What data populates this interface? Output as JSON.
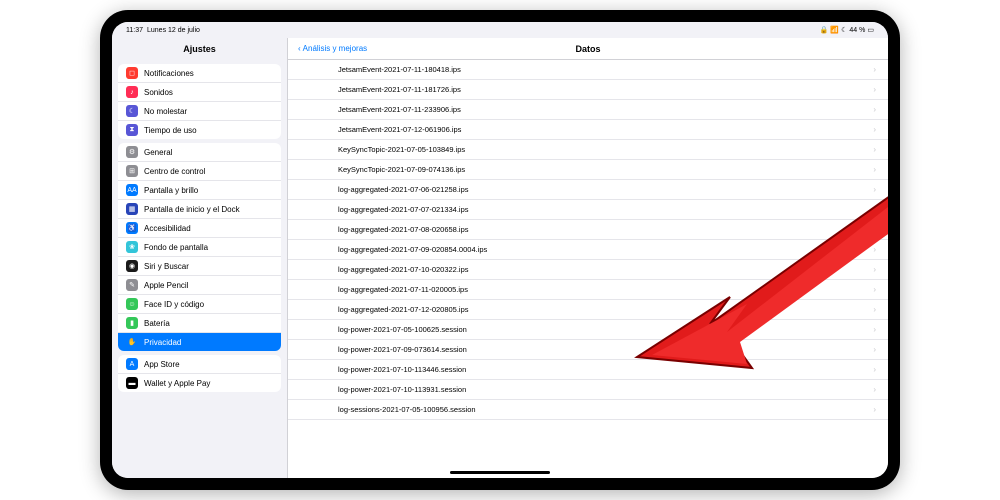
{
  "status": {
    "time": "11:37",
    "date": "Lunes 12 de julio",
    "battery": "44 %"
  },
  "sidebar": {
    "title": "Ajustes",
    "groups": [
      {
        "items": [
          {
            "label": "Notificaciones",
            "icon_bg": "#ff3b30",
            "glyph": "◻"
          },
          {
            "label": "Sonidos",
            "icon_bg": "#ff2d55",
            "glyph": "♪"
          },
          {
            "label": "No molestar",
            "icon_bg": "#5856d6",
            "glyph": "☾"
          },
          {
            "label": "Tiempo de uso",
            "icon_bg": "#5856d6",
            "glyph": "⧗"
          }
        ]
      },
      {
        "items": [
          {
            "label": "General",
            "icon_bg": "#8e8e93",
            "glyph": "⚙"
          },
          {
            "label": "Centro de control",
            "icon_bg": "#8e8e93",
            "glyph": "⊞"
          },
          {
            "label": "Pantalla y brillo",
            "icon_bg": "#007aff",
            "glyph": "AA"
          },
          {
            "label": "Pantalla de inicio y el Dock",
            "icon_bg": "#2845b8",
            "glyph": "▦"
          },
          {
            "label": "Accesibilidad",
            "icon_bg": "#007aff",
            "glyph": "♿"
          },
          {
            "label": "Fondo de pantalla",
            "icon_bg": "#33c5d9",
            "glyph": "❀"
          },
          {
            "label": "Siri y Buscar",
            "icon_bg": "#1a1a1a",
            "glyph": "◉"
          },
          {
            "label": "Apple Pencil",
            "icon_bg": "#8e8e93",
            "glyph": "✎"
          },
          {
            "label": "Face ID y código",
            "icon_bg": "#34c759",
            "glyph": "☺"
          },
          {
            "label": "Batería",
            "icon_bg": "#34c759",
            "glyph": "▮"
          },
          {
            "label": "Privacidad",
            "icon_bg": "#007aff",
            "glyph": "✋",
            "selected": true
          }
        ]
      },
      {
        "items": [
          {
            "label": "App Store",
            "icon_bg": "#007aff",
            "glyph": "A"
          },
          {
            "label": "Wallet y Apple Pay",
            "icon_bg": "#000",
            "glyph": "▬"
          }
        ]
      }
    ]
  },
  "detail": {
    "back_label": "Análisis y mejoras",
    "title": "Datos",
    "rows": [
      "JetsamEvent-2021-07-11-180418.ips",
      "JetsamEvent-2021-07-11-181726.ips",
      "JetsamEvent-2021-07-11-233906.ips",
      "JetsamEvent-2021-07-12-061906.ips",
      "KeySyncTopic-2021-07-05-103849.ips",
      "KeySyncTopic-2021-07-09-074136.ips",
      "log-aggregated-2021-07-06-021258.ips",
      "log-aggregated-2021-07-07-021334.ips",
      "log-aggregated-2021-07-08-020658.ips",
      "log-aggregated-2021-07-09-020854.0004.ips",
      "log-aggregated-2021-07-10-020322.ips",
      "log-aggregated-2021-07-11-020005.ips",
      "log-aggregated-2021-07-12-020805.ips",
      "log-power-2021-07-05-100625.session",
      "log-power-2021-07-09-073614.session",
      "log-power-2021-07-10-113446.session",
      "log-power-2021-07-10-113931.session",
      "log-sessions-2021-07-05-100956.session"
    ]
  }
}
